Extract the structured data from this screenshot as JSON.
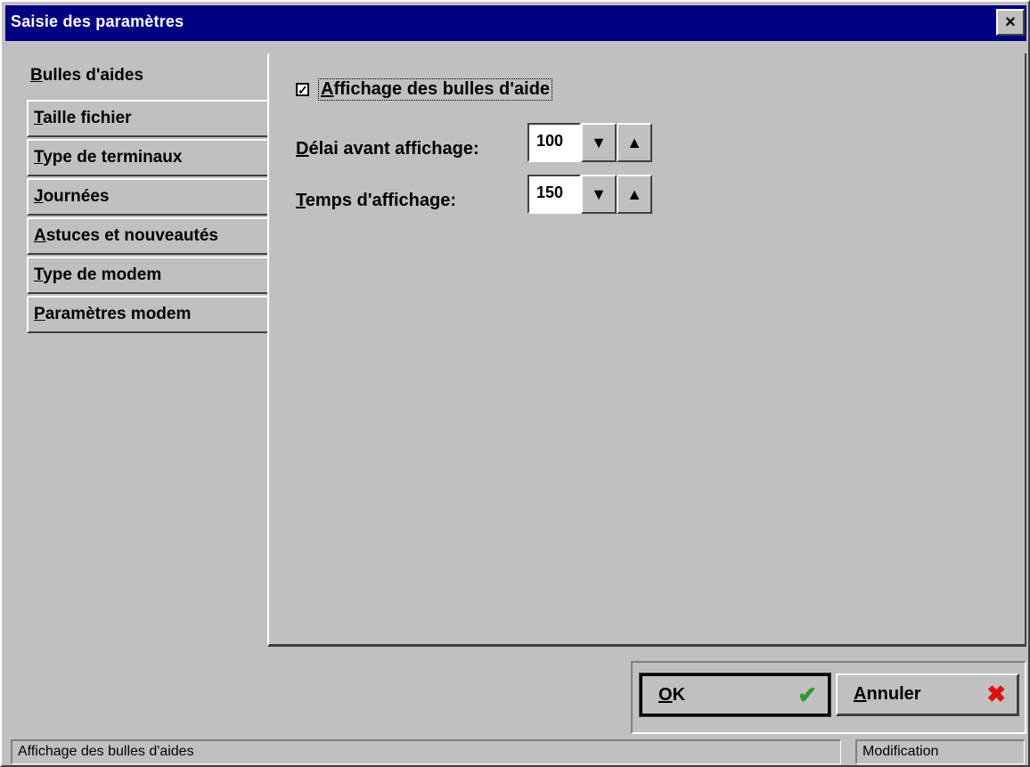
{
  "window": {
    "title": "Saisie des paramètres",
    "close_glyph": "×"
  },
  "tabs": [
    {
      "label": "Bulles d'aides",
      "access_key": "B",
      "rest": "ulles d'aides",
      "active": true
    },
    {
      "label": "Taille fichier",
      "access_key": "T",
      "rest": "aille fichier",
      "active": false
    },
    {
      "label": "Type de terminaux",
      "access_key": "T",
      "rest": "ype de terminaux",
      "active": false
    },
    {
      "label": "Journées",
      "access_key": "J",
      "rest": "ournées",
      "active": false
    },
    {
      "label": "Astuces et nouveautés",
      "access_key": "A",
      "rest": "stuces et nouveautés",
      "active": false
    },
    {
      "label": "Type de modem",
      "access_key": "T",
      "rest": "ype de modem",
      "active": false
    },
    {
      "label": "Paramètres modem",
      "access_key": "P",
      "rest": "aramètres modem",
      "active": false
    }
  ],
  "panel": {
    "show_tooltips": {
      "checked": true,
      "check_glyph": "✓",
      "access_key": "A",
      "rest": "ffichage des bulles d'aide"
    },
    "delay": {
      "access_key": "D",
      "rest": "élai avant affichage:",
      "value": "100",
      "down_glyph": "▼",
      "up_glyph": "▲"
    },
    "duration": {
      "access_key": "T",
      "rest": "emps d'affichage:",
      "value": "150",
      "down_glyph": "▼",
      "up_glyph": "▲"
    }
  },
  "buttons": {
    "ok": {
      "access_key": "O",
      "rest": "K",
      "icon": "✔"
    },
    "cancel": {
      "access_key": "A",
      "rest": "nnuler",
      "icon": "✖"
    }
  },
  "status": {
    "left": "Affichage des bulles d'aides",
    "right": "Modification"
  }
}
